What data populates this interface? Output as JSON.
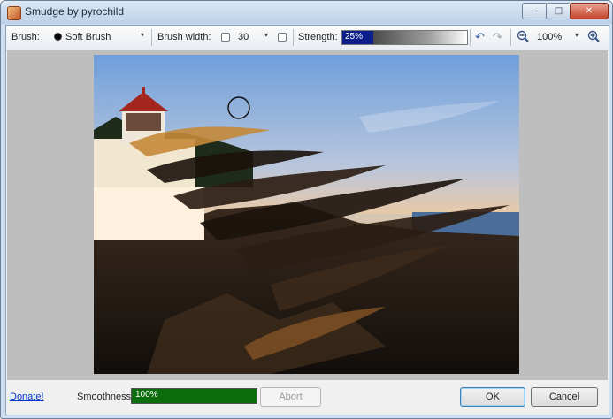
{
  "window": {
    "title": "Smudge by pyrochild",
    "controls": {
      "minimize": "‒",
      "maximize": "□",
      "close": "✕"
    }
  },
  "toolbar": {
    "brush_label": "Brush:",
    "brush_value": "Soft Brush",
    "dropdown_glyph": "▾",
    "brush_width_label": "Brush width:",
    "brush_width_value": "30",
    "strength_label": "Strength:",
    "strength_text": "25%",
    "strength_value": 0.25,
    "undo_icon": "undo-icon",
    "redo_icon": "redo-icon",
    "zoom_out_icon": "zoom-out-icon",
    "zoom_value": "100%",
    "zoom_in_icon": "zoom-in-icon"
  },
  "canvas": {
    "image": "lighthouse-smudge-photo"
  },
  "bottom": {
    "donate_link": "Donate!",
    "smoothness_label": "Smoothness:",
    "smoothness_text": "100%",
    "smoothness_value": 1.0,
    "abort_label": "Abort",
    "ok_label": "OK",
    "cancel_label": "Cancel"
  },
  "colors": {
    "strength_fill": "#0b1e8a",
    "smoothness_fill": "#0c6d0c",
    "link": "#0033cc"
  }
}
